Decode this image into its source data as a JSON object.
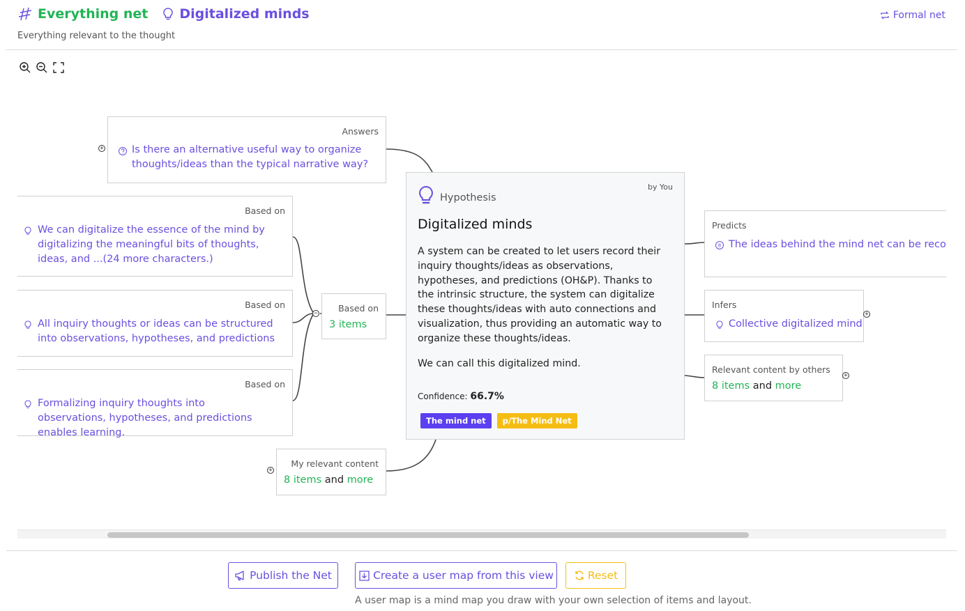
{
  "header": {
    "net_title": "Everything net",
    "mind_title": "Digitalized minds",
    "subtitle": "Everything relevant to the thought",
    "formal_link": "Formal net"
  },
  "toolbar": {
    "icons": [
      "zoom-in-icon",
      "zoom-out-icon",
      "fullscreen-icon"
    ]
  },
  "nodes": {
    "answers": {
      "label": "Answers",
      "text": "Is there an alternative useful way to organize thoughts/ideas than the typical narrative way?",
      "icon": "question-icon"
    },
    "based_on_1": {
      "label": "Based on",
      "text": "We can digitalize the essence of the mind by digitalizing the meaningful bits of thoughts, ideas, and ...(24 more characters.)",
      "icon": "bulb-icon"
    },
    "based_on_2": {
      "label": "Based on",
      "text": "All inquiry thoughts or ideas can be structured into observations, hypotheses, and predictions",
      "icon": "bulb-icon"
    },
    "based_on_3": {
      "label": "Based on",
      "text": "Formalizing inquiry thoughts into observations, hypotheses, and predictions enables learning.",
      "icon": "bulb-icon"
    },
    "based_on_group": {
      "label": "Based on",
      "count": "3 items"
    },
    "my_relevant": {
      "label": "My relevant content",
      "count": "8 items",
      "and": "and",
      "more": "more"
    },
    "predicts": {
      "label": "Predicts",
      "text": "The ideas behind the mind net can be recorded and conveyed effectively in the mind net itself",
      "icon": "prediction-icon"
    },
    "infers": {
      "label": "Infers",
      "text": "Collective digitalized mind",
      "icon": "bulb-icon"
    },
    "relevant_others": {
      "label": "Relevant content by others",
      "count": "8 items",
      "and": "and",
      "more": "more"
    }
  },
  "center": {
    "by": "by You",
    "type": "Hypothesis",
    "title": "Digitalized minds",
    "body_1": "A system can be created to let users record their inquiry thoughts/ideas as observations, hypotheses, and predictions (OH&P). Thanks to the intrinsic structure, the system can digitalize these thoughts/ideas with auto connections and visualization, thus providing an automatic way to organize these thoughts/ideas.",
    "body_2": "We can call this digitalized mind.",
    "confidence_label": "Confidence:",
    "confidence_value": "66.7%",
    "tags": [
      "The mind net",
      "p/The Mind Net"
    ]
  },
  "footer": {
    "publish": "Publish the Net",
    "create_map": "Create a user map from this view",
    "reset": "Reset",
    "note": "A user map is a mind map you draw with your own selection of items and layout."
  },
  "colors": {
    "accent_purple": "#6b4fe0",
    "accent_green": "#22b455",
    "tag_purple": "#5b3ff0",
    "tag_yellow": "#f5bd14"
  }
}
